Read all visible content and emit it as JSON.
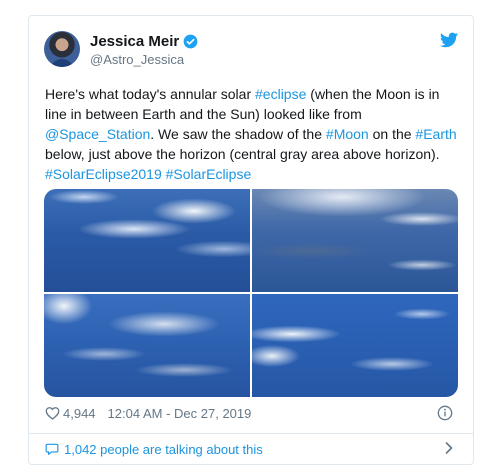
{
  "tweet": {
    "author": {
      "name": "Jessica Meir",
      "handle": "@Astro_Jessica",
      "verified": true
    },
    "text": {
      "t1": "Here's what today's annular solar ",
      "l1": "#eclipse",
      "t2": " (when the Moon is in line in between Earth and the Sun) looked like from ",
      "l2": "@Space_Station",
      "t3": ". We saw the shadow of the ",
      "l3": "#Moon",
      "t4": " on the ",
      "l4": "#Earth",
      "t5": " below, just above the horizon (central gray area above horizon).  ",
      "l5": "#SolarEclipse2019",
      "t6": " ",
      "l6": "#SolarEclipse"
    },
    "likes": "4,944",
    "timestamp": "12:04 AM - Dec 27, 2019",
    "footer_text": "1,042 people are talking about this"
  },
  "colors": {
    "link": "#1b95e0",
    "text": "#14171a",
    "secondary": "#657786",
    "border": "#e1e8ed"
  },
  "icons": {
    "verified": "verified-badge-icon",
    "brand": "twitter-bird-icon",
    "like": "heart-outline-icon",
    "info": "info-circle-icon",
    "comments": "speech-bubble-icon",
    "more": "chevron-right-icon"
  }
}
